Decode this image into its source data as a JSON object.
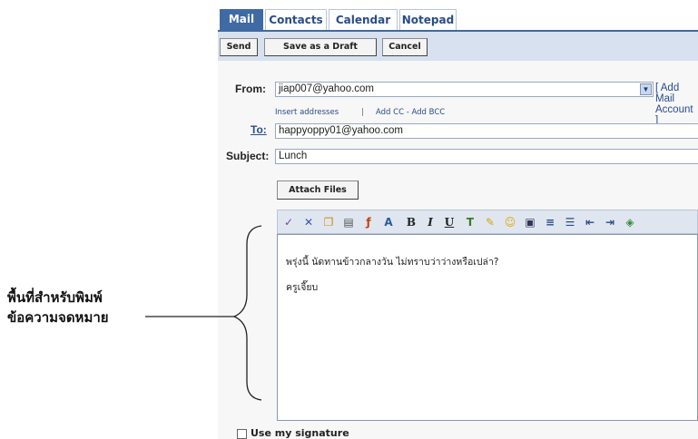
{
  "tabs": [
    {
      "label": "Mail"
    },
    {
      "label": "Contacts"
    },
    {
      "label": "Calendar"
    },
    {
      "label": "Notepad"
    }
  ],
  "toolbar": {
    "send_label": "Send",
    "draft_label": "Save as a Draft",
    "cancel_label": "Cancel"
  },
  "form": {
    "from_label": "From:",
    "from_value": "jiap007@yahoo.com",
    "add_account": "[ Add Mail Account ]",
    "insert_addresses": "Insert addresses",
    "separator": "|",
    "add_cc_bcc": "Add CC - Add BCC",
    "to_label": "To:",
    "to_value": "happyoppy01@yahoo.com",
    "subject_label": "Subject:",
    "subject_value": "Lunch",
    "attach_label": "Attach Files"
  },
  "editor_toolbar": {
    "icons": [
      "spellcheck-icon",
      "cut-icon",
      "copy-icon",
      "paste-icon",
      "font-icon",
      "font-size-icon",
      "bold-icon",
      "italic-icon",
      "underline-icon",
      "text-color-icon",
      "highlight-icon",
      "emoticon-icon",
      "insert-image-icon",
      "align-icon",
      "bullet-list-icon",
      "outdent-icon",
      "indent-icon",
      "link-icon"
    ],
    "bold_glyph": "B",
    "italic_glyph": "I",
    "underline_glyph": "U"
  },
  "editor": {
    "line1": "พรุ่งนี้ นัดทานข้าวกลางวัน ไม่ทราบว่าว่างหรือเปล่า?",
    "line2": "ครูเจี๊ยบ"
  },
  "signature": {
    "label": "Use my signature"
  },
  "annotation": {
    "line1": "พื้นที่สำหรับพิมพ์",
    "line2": "ข้อความจดหมาย"
  },
  "colors": {
    "tab_active": "#3f6aa3",
    "toolbar_bg": "#d7e1ef",
    "link": "#2a4c8a"
  }
}
